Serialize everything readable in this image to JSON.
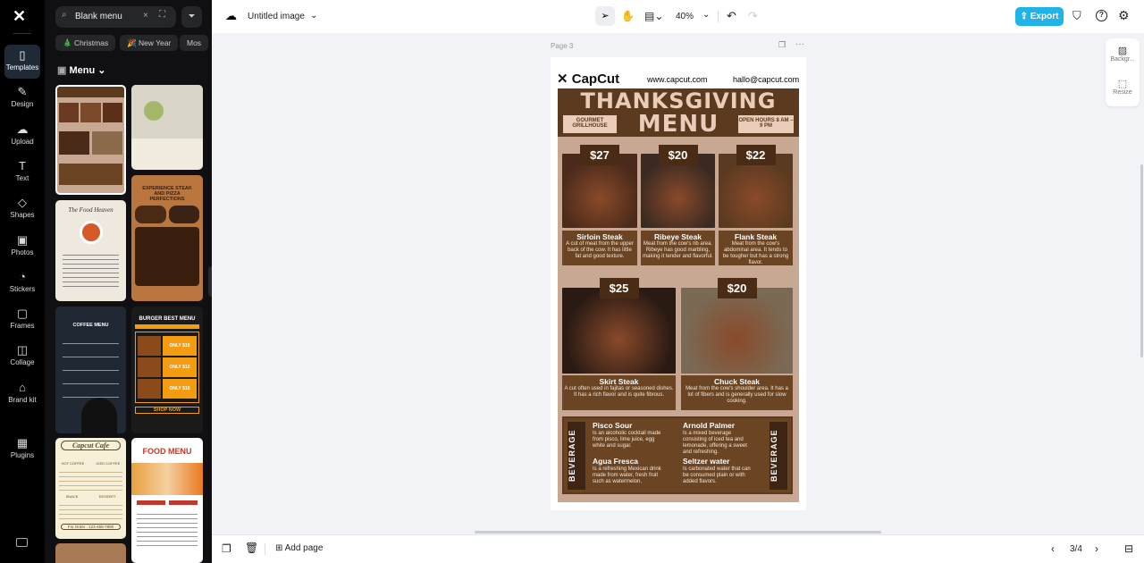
{
  "rail": {
    "items": [
      {
        "label": "Templates",
        "icon": "templates-icon"
      },
      {
        "label": "Design",
        "icon": "design-icon"
      },
      {
        "label": "Upload",
        "icon": "upload-icon"
      },
      {
        "label": "Text",
        "icon": "text-icon"
      },
      {
        "label": "Shapes",
        "icon": "shapes-icon"
      },
      {
        "label": "Photos",
        "icon": "photos-icon"
      },
      {
        "label": "Stickers",
        "icon": "stickers-icon"
      },
      {
        "label": "Frames",
        "icon": "frames-icon"
      },
      {
        "label": "Collage",
        "icon": "collage-icon"
      },
      {
        "label": "Brand kit",
        "icon": "brand-kit-icon"
      },
      {
        "label": "Plugins",
        "icon": "plugins-icon"
      }
    ]
  },
  "panel": {
    "search_value": "Blank menu",
    "chips": [
      "🎄 Christmas",
      "🎉 New Year",
      "Mos"
    ],
    "category": "Menu",
    "thumbs": {
      "food_heaven": "The Food Heaven",
      "steak_pizza": "EXPERIENCE STEAK AND PIZZA PERFECTIONS",
      "coffee": "COFFEE MENU",
      "burger": "BURGER BEST MENU",
      "burger_cta": "SHOP NOW",
      "burger_prices": [
        "ONLY $15",
        "ONLY $12",
        "ONLY $10"
      ],
      "cafe": "Capcut Cafe",
      "cafe_sections": [
        "HOT COFFEE",
        "ICED COFFEE",
        "SNACK",
        "DESSERT"
      ],
      "cafe_order": "For Order : 123-456-7890",
      "food_menu": "FOOD MENU"
    }
  },
  "topbar": {
    "title": "Untitled image",
    "zoom": "40%",
    "export_label": "Export",
    "accent": "#1fb3e8"
  },
  "canvas": {
    "page_label": "Page 3"
  },
  "side_tools": [
    {
      "label": "Backgr...",
      "icon": "background-icon"
    },
    {
      "label": "Resize",
      "icon": "resize-icon"
    }
  ],
  "bottombar": {
    "add_page": "Add page",
    "pagination": "3/4"
  },
  "menu": {
    "brand": "CapCut",
    "website": "www.capcut.com",
    "email": "hallo@capcut.com",
    "title1": "THANKSGIVING",
    "title2": "MENU",
    "left_box": "GOURMET GRILLHOUSE",
    "right_box": "OPEN HOURS 8 AM – 9 PM",
    "steaks": [
      {
        "price": "$27",
        "name": "Sirloin Steak",
        "desc": "A cut of meat from the upper back of the cow. It has little fat and good texture."
      },
      {
        "price": "$20",
        "name": "Ribeye Steak",
        "desc": "Meat from the cow's rib area. Ribeye has good marbling, making it tender and flavorful."
      },
      {
        "price": "$22",
        "name": "Flank Steak",
        "desc": "Meat from the cow's abdominal area. It tends to be tougher but has a strong flavor."
      },
      {
        "price": "$25",
        "name": "Skirt Steak",
        "desc": "A cut often used in fajitas or seasoned dishes. It has a rich flavor and is quite fibrous."
      },
      {
        "price": "$20",
        "name": "Chuck Steak",
        "desc": "Meat from the cow's shoulder area. It has a lot of fibers and is generally used for slow cooking."
      }
    ],
    "beverage_label": "BEVERAGE",
    "beverages": [
      {
        "name": "Pisco Sour",
        "desc": "Is an alcoholic cocktail made from pisco, lime juice, egg white and sugar."
      },
      {
        "name": "Arnold Palmer",
        "desc": "Is a mixed beverage consisting of iced tea and lemonade, offering a sweet and refreshing."
      },
      {
        "name": "Agua Fresca",
        "desc": "Is a refreshing Mexican drink made from water, fresh fruit such as watermelon."
      },
      {
        "name": "Seltzer water",
        "desc": "Is carbonated water that can be consumed plain or with added flavors."
      }
    ]
  }
}
